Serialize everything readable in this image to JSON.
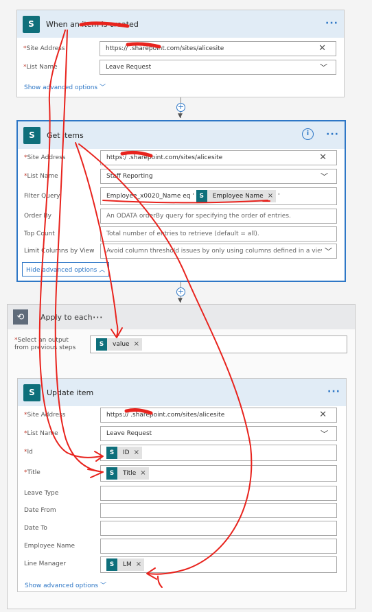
{
  "card1": {
    "title": "When an item is created",
    "more": "···",
    "site_label": "Site Address",
    "site_value": "https://  .sharepoint.com/sites/alicesite",
    "list_label": "List Name",
    "list_value": "Leave Request",
    "advanced": "Show advanced options ﹀"
  },
  "card2": {
    "title": "Get items",
    "more": "···",
    "info": "i",
    "site_label": "Site Address",
    "site_value": "https:/  .sharepoint.com/sites/alicesite",
    "list_label": "List Name",
    "list_value": "Staff Reporting",
    "filter_label": "Filter Query",
    "filter_prefix": "Employee_x0020_Name eq '",
    "filter_token": "Employee Name",
    "filter_suffix": "'",
    "order_label": "Order By",
    "order_placeholder": "An ODATA orderBy query for specifying the order of entries.",
    "top_label": "Top Count",
    "top_placeholder": "Total number of entries to retrieve (default = all).",
    "limit_label": "Limit Columns by View",
    "limit_placeholder": "Avoid column threshold issues by only using columns defined in a view",
    "advanced": "Hide advanced options ︿"
  },
  "apply": {
    "title": "Apply to each",
    "more": "···",
    "select_label_line1": "Select an output",
    "select_label_line2": "from previous steps",
    "select_token": "value"
  },
  "card3": {
    "title": "Update item",
    "more": "···",
    "site_label": "Site Address",
    "site_value": "https://  .sharepoint.com/sites/alicesite",
    "list_label": "List Name",
    "list_value": "Leave Request",
    "id_label": "Id",
    "id_token": "ID",
    "title_label": "Title",
    "title_token": "Title",
    "leave_type_label": "Leave Type",
    "date_from_label": "Date From",
    "date_to_label": "Date To",
    "employee_name_label": "Employee Name",
    "line_manager_label": "Line Manager",
    "line_manager_token": "LM",
    "advanced": "Show advanced options ﹀"
  },
  "common": {
    "sp_icon": "S",
    "token_icon": "S",
    "token_remove": "×",
    "clear": "✕",
    "chevron": "﹀",
    "required": "*",
    "plus": "+",
    "arrow": "▼",
    "loop_icon": "⟲"
  },
  "colors": {
    "accent": "#2e77c6",
    "sharepoint": "#0e6f7b",
    "annotation": "#e8231d"
  }
}
